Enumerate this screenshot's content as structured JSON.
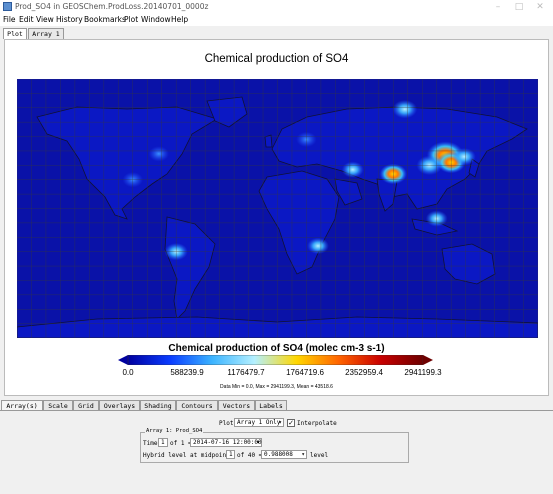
{
  "window": {
    "title": "Prod_SO4 in GEOSChem.ProdLoss.20140701_0000z",
    "controls": [
      "–",
      "□",
      "✕"
    ]
  },
  "menu": [
    "File",
    "Edit",
    "View",
    "History",
    "Bookmarks",
    "Plot",
    "Window",
    "Help"
  ],
  "top_tabs": [
    "Plot",
    "Array 1"
  ],
  "colors": {
    "ocean_low": "#0a12a8",
    "land_low": "#0a16c8",
    "grid": "#3a3a3a",
    "coast": "#111133"
  },
  "chart_data": {
    "type": "heatmap",
    "title": "Chemical production of SO4",
    "colorbar": {
      "label": "Chemical production of SO4 (molec cm-3 s-1)",
      "ticks": [
        "0.0",
        "588239.9",
        "1176479.7",
        "1764719.6",
        "2352959.4",
        "2941199.3"
      ],
      "range": [
        0.0,
        2941199.3
      ],
      "colors": [
        "#0000a0",
        "#0a3cff",
        "#3cb4ff",
        "#b4f0ff",
        "#ffd700",
        "#ff6400",
        "#c80000",
        "#6e0000"
      ]
    },
    "stats": "Data Min = 0.0, Max = 2941199.3, Mean = 43518.6",
    "hotspots": [
      {
        "region": "North China",
        "lon": 116,
        "lat": 37,
        "level": 0.9
      },
      {
        "region": "East China",
        "lon": 120,
        "lat": 32,
        "level": 0.6
      },
      {
        "region": "Sichuan",
        "lon": 105,
        "lat": 30,
        "level": 0.5
      },
      {
        "region": "India",
        "lon": 80,
        "lat": 24,
        "level": 0.55
      },
      {
        "region": "Persian Gulf",
        "lon": 52,
        "lat": 27,
        "level": 0.35
      },
      {
        "region": "Europe",
        "lon": 20,
        "lat": 48,
        "level": 0.3
      },
      {
        "region": "Eastern US",
        "lon": -82,
        "lat": 38,
        "level": 0.3
      },
      {
        "region": "Mexico",
        "lon": -100,
        "lat": 20,
        "level": 0.3
      },
      {
        "region": "Chile",
        "lon": -70,
        "lat": -30,
        "level": 0.4
      },
      {
        "region": "South Africa",
        "lon": 28,
        "lat": -26,
        "level": 0.35
      },
      {
        "region": "Indonesia",
        "lon": 110,
        "lat": -7,
        "level": 0.35
      },
      {
        "region": "Russia",
        "lon": 88,
        "lat": 69,
        "level": 0.45
      },
      {
        "region": "Korea/Japan",
        "lon": 129,
        "lat": 36,
        "level": 0.4
      }
    ]
  },
  "bottom_tabs": [
    "Array(s)",
    "Scale",
    "Grid",
    "Overlays",
    "Shading",
    "Contours",
    "Vectors",
    "Labels"
  ],
  "controls": {
    "plot_label": "Plot",
    "plot_value": "Array 1 Only",
    "interpolate_label": "Interpolate",
    "interpolate_checked": true,
    "array_group_label": "Array 1: Prod_SO4",
    "time_label": "Time",
    "time_index": "1",
    "time_of": "of 1 =",
    "time_value": "2014-07-16 12:00:00",
    "level_label": "Hybrid level at midpoints",
    "level_index": "1",
    "level_of": "of 40 =",
    "level_value": "0.988008",
    "level_unit": "level"
  }
}
